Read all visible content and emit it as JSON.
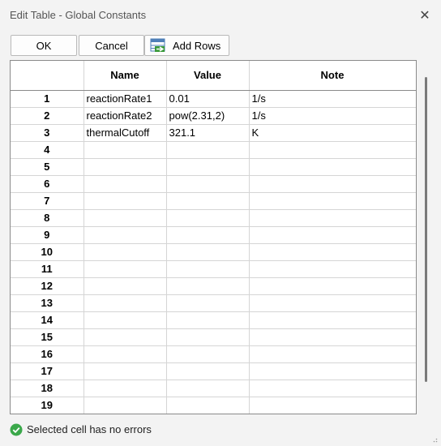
{
  "window": {
    "title": "Edit Table - Global Constants",
    "close_glyph": "✕"
  },
  "toolbar": {
    "ok_label": "OK",
    "cancel_label": "Cancel",
    "add_rows_label": "Add Rows",
    "add_rows_icon": "add-rows-icon"
  },
  "table": {
    "headers": [
      "",
      "Name",
      "Value",
      "Note"
    ],
    "rows": [
      {
        "num": "1",
        "name": "reactionRate1",
        "value": "0.01",
        "note": "1/s"
      },
      {
        "num": "2",
        "name": "reactionRate2",
        "value": "pow(2.31,2)",
        "note": "1/s"
      },
      {
        "num": "3",
        "name": "thermalCutoff",
        "value": "321.1",
        "note": "K"
      },
      {
        "num": "4",
        "name": "",
        "value": "",
        "note": ""
      },
      {
        "num": "5",
        "name": "",
        "value": "",
        "note": ""
      },
      {
        "num": "6",
        "name": "",
        "value": "",
        "note": ""
      },
      {
        "num": "7",
        "name": "",
        "value": "",
        "note": ""
      },
      {
        "num": "8",
        "name": "",
        "value": "",
        "note": ""
      },
      {
        "num": "9",
        "name": "",
        "value": "",
        "note": ""
      },
      {
        "num": "10",
        "name": "",
        "value": "",
        "note": ""
      },
      {
        "num": "11",
        "name": "",
        "value": "",
        "note": ""
      },
      {
        "num": "12",
        "name": "",
        "value": "",
        "note": ""
      },
      {
        "num": "13",
        "name": "",
        "value": "",
        "note": ""
      },
      {
        "num": "14",
        "name": "",
        "value": "",
        "note": ""
      },
      {
        "num": "15",
        "name": "",
        "value": "",
        "note": ""
      },
      {
        "num": "16",
        "name": "",
        "value": "",
        "note": ""
      },
      {
        "num": "17",
        "name": "",
        "value": "",
        "note": ""
      },
      {
        "num": "18",
        "name": "",
        "value": "",
        "note": ""
      },
      {
        "num": "19",
        "name": "",
        "value": "",
        "note": ""
      }
    ]
  },
  "status": {
    "text": "Selected cell has no errors",
    "icon": "check-circle-icon",
    "color": "#3aa84a"
  }
}
